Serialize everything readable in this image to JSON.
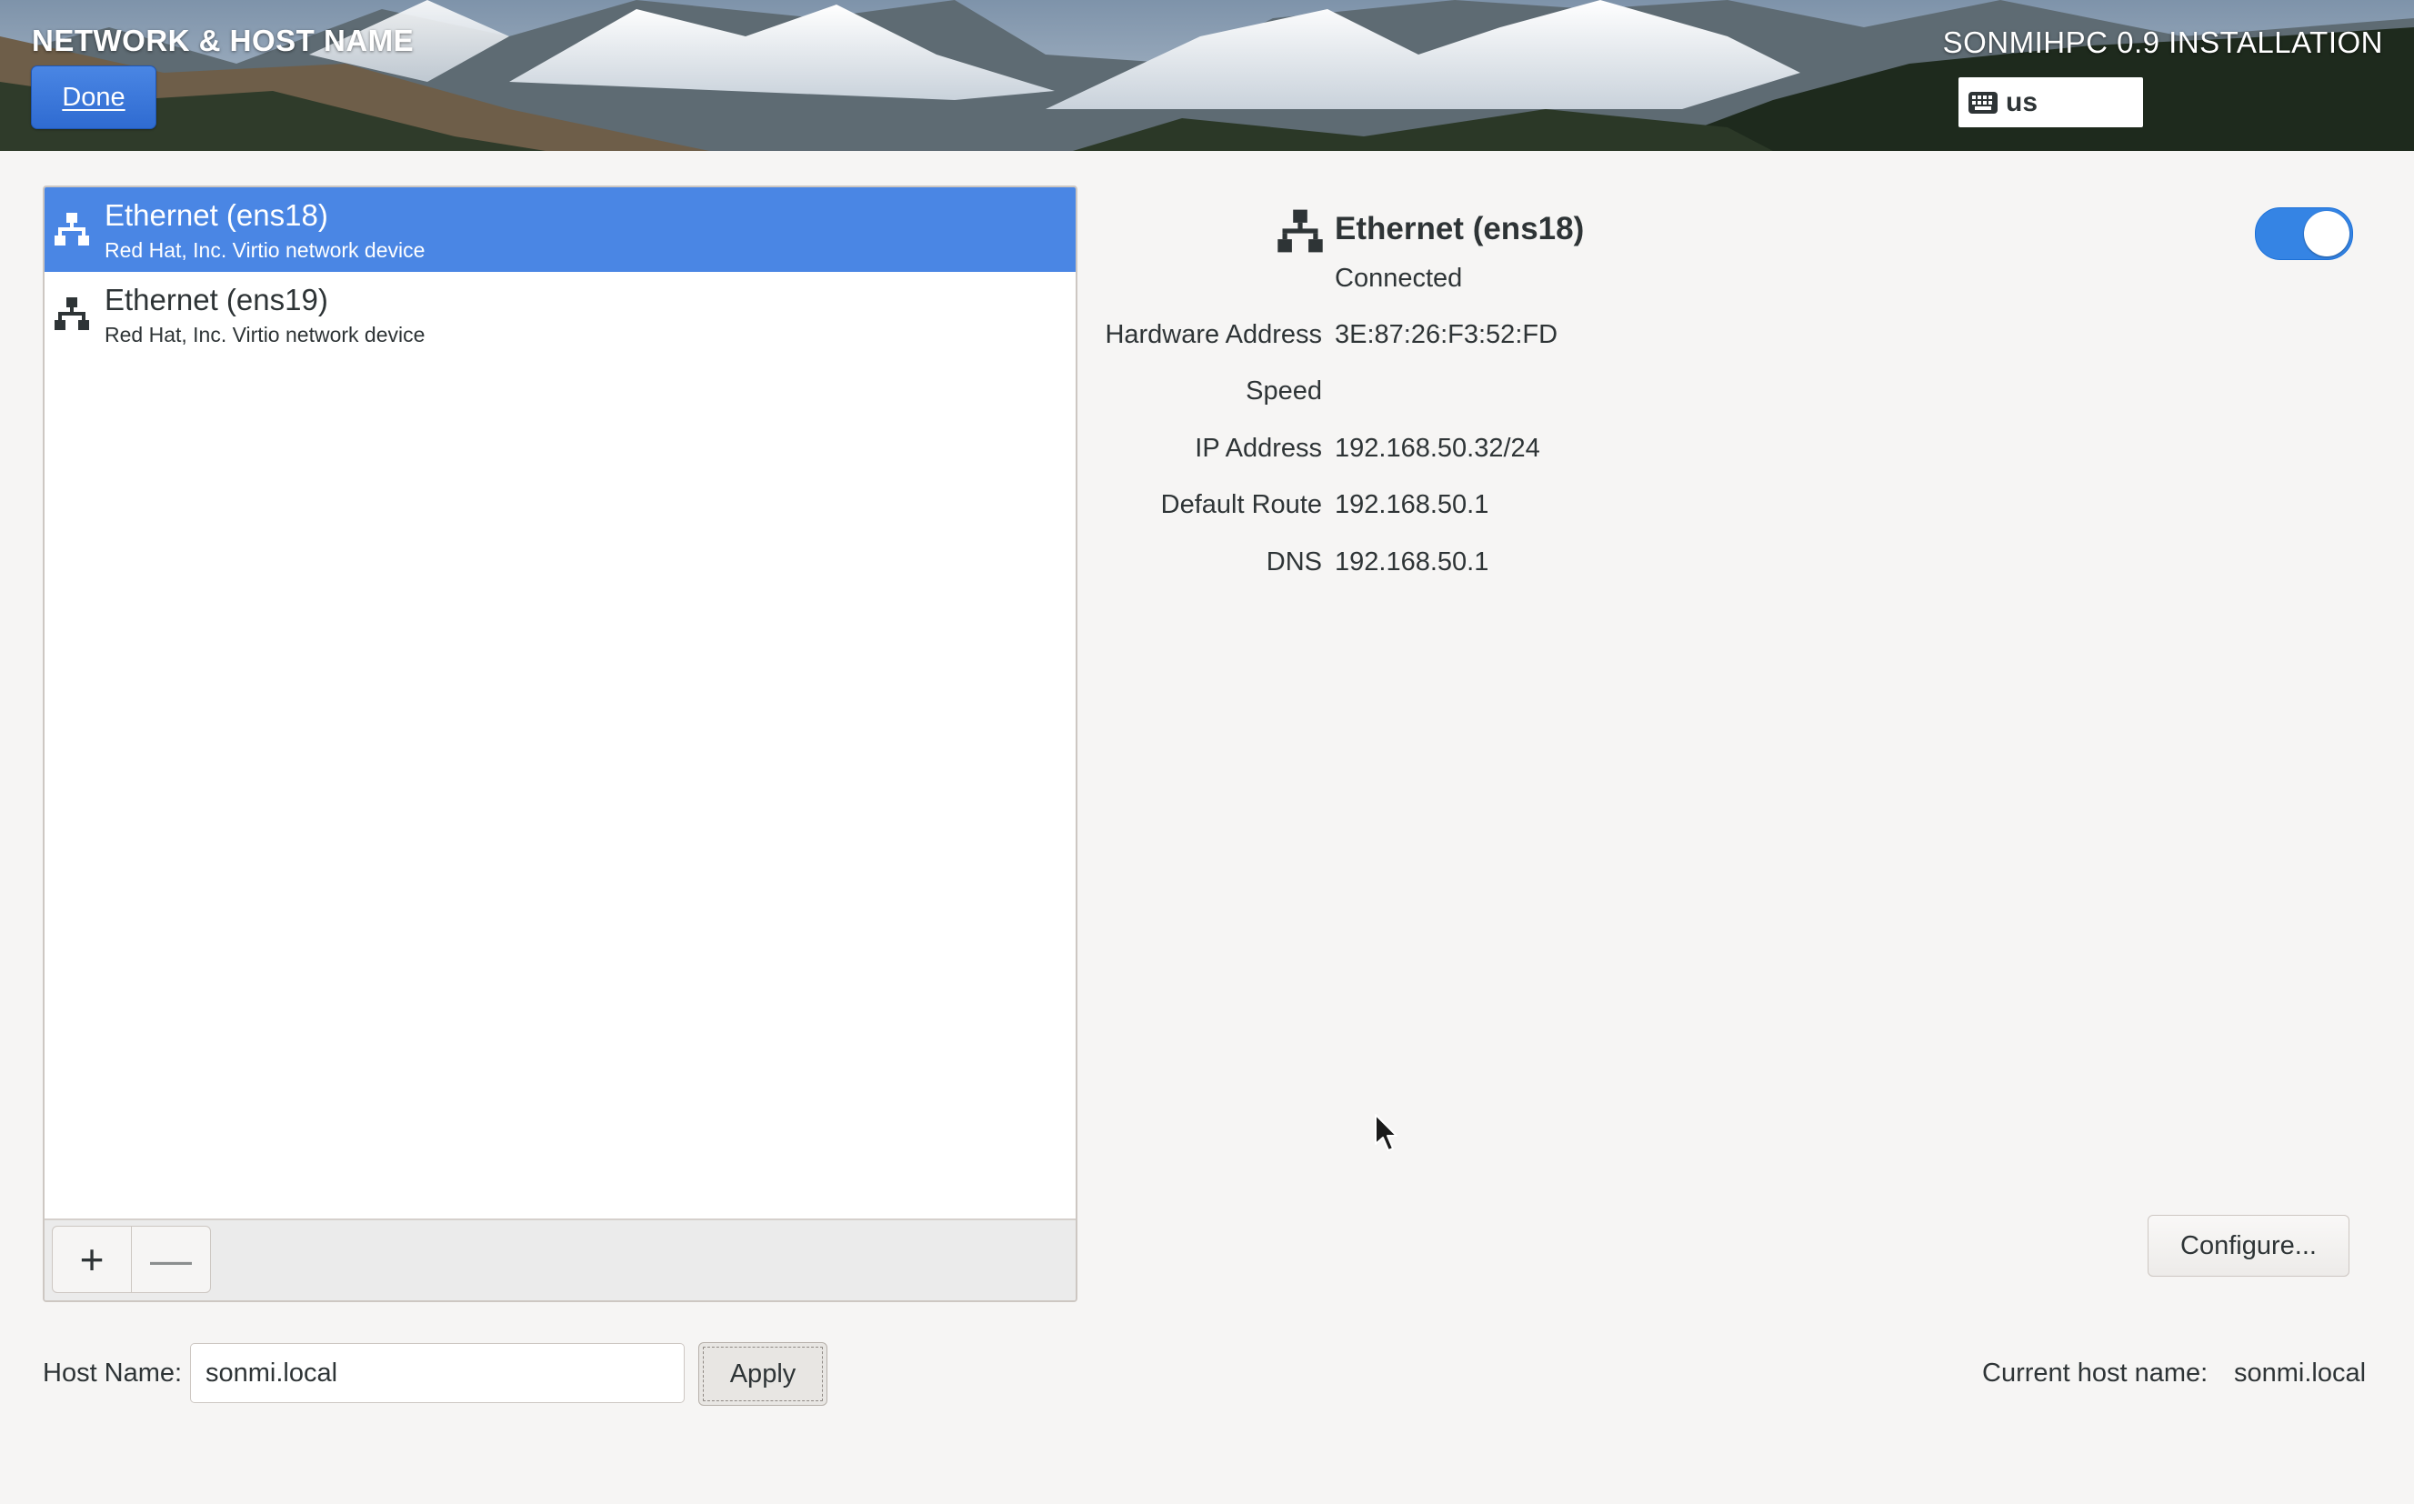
{
  "header": {
    "spoke_title": "NETWORK & HOST NAME",
    "done_label": "Done",
    "product_title": "SONMIHPC 0.9 INSTALLATION",
    "keyboard_layout": "us",
    "keyboard_icon": "keyboard-icon"
  },
  "devices": [
    {
      "name": "Ethernet (ens18)",
      "description": "Red Hat, Inc. Virtio network device",
      "selected": true,
      "icon": "network-wired-icon"
    },
    {
      "name": "Ethernet (ens19)",
      "description": "Red Hat, Inc. Virtio network device",
      "selected": false,
      "icon": "network-wired-icon"
    }
  ],
  "list_toolbar": {
    "add_label": "+",
    "remove_label": "—"
  },
  "detail": {
    "name": "Ethernet (ens18)",
    "status": "Connected",
    "enabled": true,
    "properties": [
      {
        "label": "Hardware Address",
        "value": "3E:87:26:F3:52:FD"
      },
      {
        "label": "Speed",
        "value": ""
      },
      {
        "label": "IP Address",
        "value": "192.168.50.32/24"
      },
      {
        "label": "Default Route",
        "value": "192.168.50.1"
      },
      {
        "label": "DNS",
        "value": "192.168.50.1"
      }
    ],
    "configure_label": "Configure..."
  },
  "hostname": {
    "label": "Host Name:",
    "value": "sonmi.local",
    "apply_label": "Apply",
    "current_label": "Current host name:",
    "current_value": "sonmi.local"
  },
  "colors": {
    "accent": "#4a86e4",
    "toggle_on": "#3584e4",
    "background": "#f6f5f4"
  }
}
